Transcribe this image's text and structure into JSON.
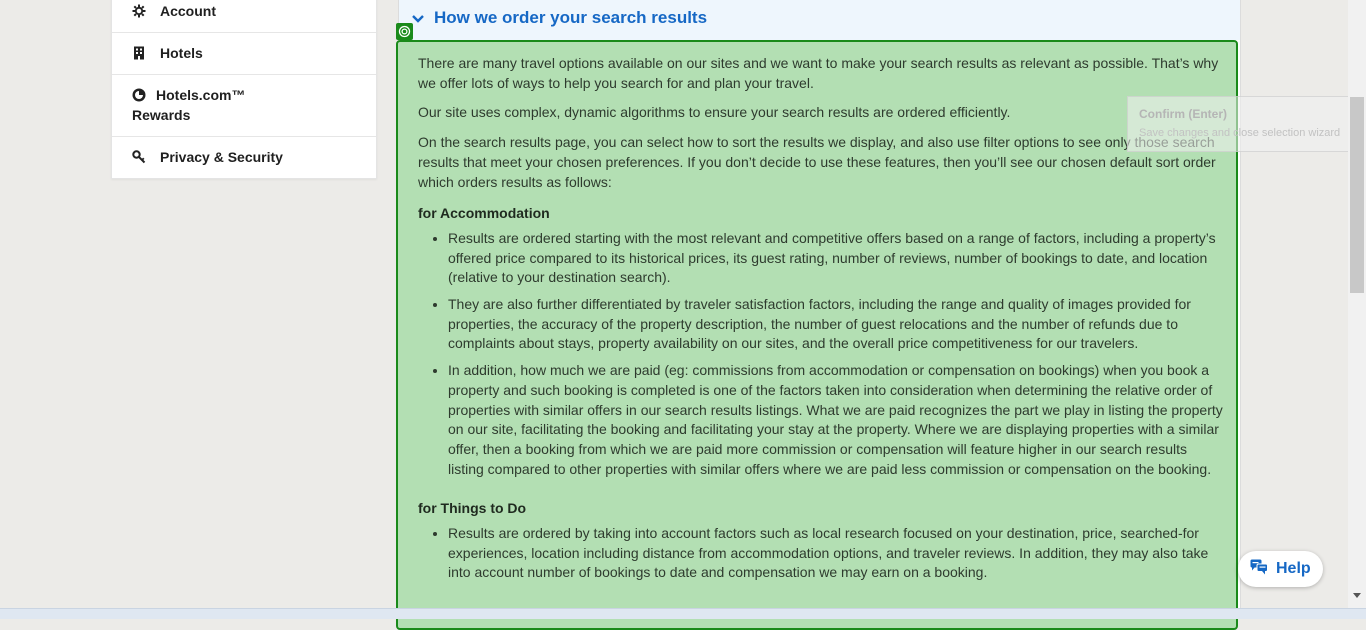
{
  "sidebar": {
    "items": [
      {
        "label": "Account",
        "icon": "gear-icon"
      },
      {
        "label": "Hotels",
        "icon": "building-icon"
      },
      {
        "label": "Hotels.com™",
        "label_line2": "Rewards",
        "icon": "rewards-icon"
      },
      {
        "label": "Privacy & Security",
        "icon": "key-icon"
      }
    ]
  },
  "section": {
    "title": "How we order your search results",
    "paragraphs": [
      "There are many travel options available on our sites and we want to make your search results as relevant as possible. That’s why we offer lots of ways to help you search for and plan your travel.",
      "Our site uses complex, dynamic algorithms to ensure your search results are ordered efficiently.",
      "On the search results page, you can select how to sort the results we display, and also use filter options to see only those search results that meet your chosen preferences. If you don’t decide to use these features, then you’ll see our chosen default sort order which orders results as follows:"
    ],
    "accommodation": {
      "heading": "for Accommodation",
      "bullets": [
        "Results are ordered starting with the most relevant and competitive offers based on a range of factors, including a property’s offered price compared to its historical prices, its guest rating, number of reviews, number of bookings to date, and location (relative to your destination search).",
        "They are also further differentiated by traveler satisfaction factors, including the range and quality of images provided for properties, the accuracy of the property description, the number of guest relocations and the number of refunds due to complaints about stays, property availability on our sites, and the overall price competitiveness for our travelers.",
        "In addition, how much we are paid (eg: commissions from accommodation or compensation on bookings) when you book a property and such booking is completed is one of the factors taken into consideration when determining the relative order of properties with similar offers in our search results listings. What we are paid recognizes the part we play in listing the property on our site, facilitating the booking and facilitating your stay at the property. Where we are displaying properties with a similar offer, then a booking from which we are paid more commission or compensation will feature higher in our search results listing compared to other properties with similar offers where we are paid less commission or compensation on the booking."
      ]
    },
    "things_to_do": {
      "heading": "for Things to Do",
      "bullets": [
        "Results are ordered by taking into account factors such as local research focused on your destination, price, searched-for experiences, location including distance from accommodation options, and traveler reviews. In addition, they may also take into account number of bookings to date and compensation we may earn on a booking."
      ]
    }
  },
  "confirm_tip": {
    "title": "Confirm (Enter)",
    "subtitle": "Save changes and close selection wizard"
  },
  "help": {
    "label": "Help"
  },
  "colors": {
    "accent": "#1668c5",
    "selection_fill": "#b3dfb3",
    "selection_border": "#1a8a1a",
    "header_bg": "#eef6fd"
  }
}
